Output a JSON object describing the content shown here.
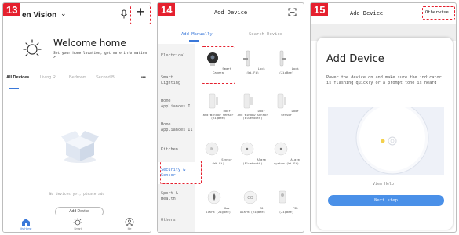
{
  "steps": {
    "s13": "13",
    "s14": "14",
    "s15": "15"
  },
  "colors": {
    "accent": "#3a78d9",
    "highlight": "#e5202e",
    "button": "#4a90e8"
  },
  "screen13": {
    "home_name": "en Vision",
    "welcome_title": "Welcome home",
    "welcome_sub": "Set your home location, get more information >",
    "tabs": [
      "All Devices",
      "Living R…",
      "Bedroom",
      "Second B…"
    ],
    "more": "•••",
    "empty_text": "No devices yet, please add",
    "add_button": "Add Device",
    "nav": {
      "home": "My Home",
      "smart": "Smart",
      "me": "Me"
    },
    "icons": [
      "chevron-down-icon",
      "mic-icon",
      "plus-icon",
      "sun-icon",
      "box-icon",
      "home-icon",
      "smart-icon",
      "me-icon"
    ]
  },
  "screen14": {
    "title": "Add Device",
    "tab_manual": "Add Manually",
    "tab_scan": "Search Device",
    "categories": [
      "Electrical",
      "Smart Lighting",
      "Home Appliances I",
      "Home Appliances II",
      "Kitchen",
      "Security & Sensor",
      "Sport & Health",
      "Others"
    ],
    "active_category": "Security & Sensor",
    "devices": [
      {
        "label": "Smart Camera",
        "icon": "camera-icon"
      },
      {
        "label": "Lock (Wi-Fi)",
        "icon": "lock-icon"
      },
      {
        "label": "Lock (ZigBee)",
        "icon": "lock-icon"
      },
      {
        "label": "Door and Window Sensor (ZigBee)",
        "icon": "door-sensor-icon"
      },
      {
        "label": "Door And Window Sensor (Bluetooth)",
        "icon": "door-sensor-icon"
      },
      {
        "label": "Door Sensor",
        "icon": "door-sensor-icon"
      },
      {
        "label": "Sensor (Wi-Fi)",
        "icon": "sensor-icon"
      },
      {
        "label": "Alarm (Bluetooth)",
        "icon": "alarm-icon"
      },
      {
        "label": "Alarm system (Wi-Fi)",
        "icon": "alarm-icon"
      },
      {
        "label": "Gas Alarm (ZigBee)",
        "icon": "gas-alarm-icon"
      },
      {
        "label": "CO Alarm (ZigBee)",
        "icon": "co-alarm-icon"
      },
      {
        "label": "PIR (ZigBee)",
        "icon": "pir-icon"
      }
    ]
  },
  "screen15": {
    "title": "Add Device",
    "otherwise": "Otherwise",
    "heading": "Add Device",
    "description": "Power the device on and make sure the indicator is flashing quickly or a prompt tone is heard",
    "help": "View Help",
    "next": "Next step"
  }
}
